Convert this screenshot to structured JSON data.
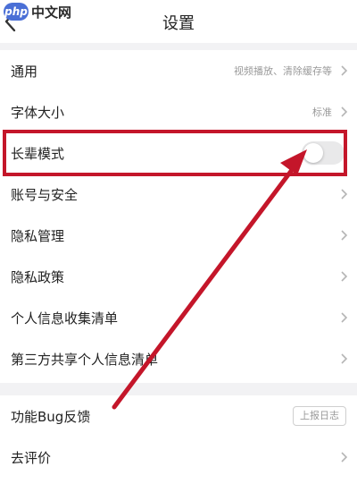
{
  "watermark": {
    "logo": "php",
    "text": "中文网"
  },
  "header": {
    "title": "设置"
  },
  "settings": {
    "general": {
      "label": "通用",
      "value": "视频播放、清除缓存等"
    },
    "font_size": {
      "label": "字体大小",
      "value": "标准"
    },
    "elder_mode": {
      "label": "长辈模式",
      "enabled": false
    },
    "account_security": {
      "label": "账号与安全"
    },
    "privacy_management": {
      "label": "隐私管理"
    },
    "privacy_policy": {
      "label": "隐私政策"
    },
    "personal_info_list": {
      "label": "个人信息收集清单"
    },
    "third_party_list": {
      "label": "第三方共享个人信息清单"
    },
    "bug_feedback": {
      "label": "功能Bug反馈",
      "button": "上报日志"
    },
    "rate": {
      "label": "去评价"
    }
  },
  "colors": {
    "annotation": "#c4162a",
    "background": "#f2f2f4",
    "card": "#ffffff",
    "toggle_off": "#e9e9ea"
  }
}
